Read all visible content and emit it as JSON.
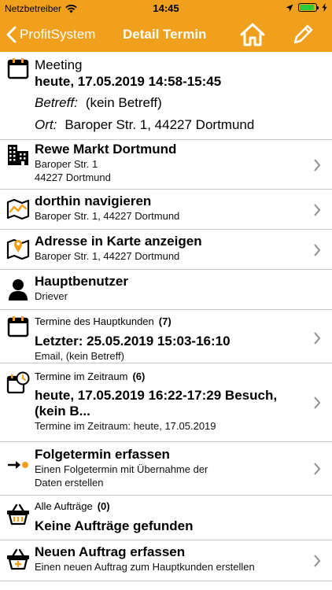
{
  "statusbar": {
    "carrier": "Netzbetreiber",
    "time": "14:45",
    "battery_level": 0.9
  },
  "navbar": {
    "back_label": "ProfitSystem",
    "title": "Detail Termin"
  },
  "meeting": {
    "type": "Meeting",
    "datetime": "heute, 17.05.2019 14:58-15:45",
    "subject_label": "Betreff:",
    "subject_value": "(kein Betreff)",
    "location_label": "Ort:",
    "location_value": "Baroper Str. 1, 44227 Dortmund"
  },
  "customer": {
    "name": "Rewe Markt Dortmund",
    "street": "Baroper Str. 1",
    "city": "44227 Dortmund"
  },
  "navigate": {
    "title": "dorthin navigieren",
    "address": "Baroper Str. 1, 44227 Dortmund"
  },
  "map": {
    "title": "Adresse in Karte anzeigen",
    "address": "Baroper Str. 1, 44227 Dortmund"
  },
  "user": {
    "title": "Hauptbenutzer",
    "name": "Driever"
  },
  "customer_appointments": {
    "label": "Termine des Hauptkunden",
    "count": "(7)",
    "latest": "Letzter: 25.05.2019 15:03-16:10",
    "details": "Email, (kein Betreff)"
  },
  "period_appointments": {
    "label": "Termine im Zeitraum",
    "count": "(6)",
    "line1": "heute, 17.05.2019 16:22-17:29 Besuch,",
    "line2": "(kein B...",
    "details": "Termine im Zeitraum: heute, 17.05.2019"
  },
  "follow_up": {
    "title": "Folgetermin erfassen",
    "desc_line1": "Einen Folgetermin mit Übernahme der",
    "desc_line2": "Daten erstellen"
  },
  "orders": {
    "label": "Alle Aufträge",
    "count": "(0)",
    "empty": "Keine Aufträge gefunden"
  },
  "new_order": {
    "title": "Neuen Auftrag erfassen",
    "desc": "Einen neuen Auftrag zum Hauptkunden erstellen"
  },
  "colors": {
    "accent": "#f0a01c",
    "separator": "#c8c8cc",
    "chevron": "#8e8e93"
  }
}
